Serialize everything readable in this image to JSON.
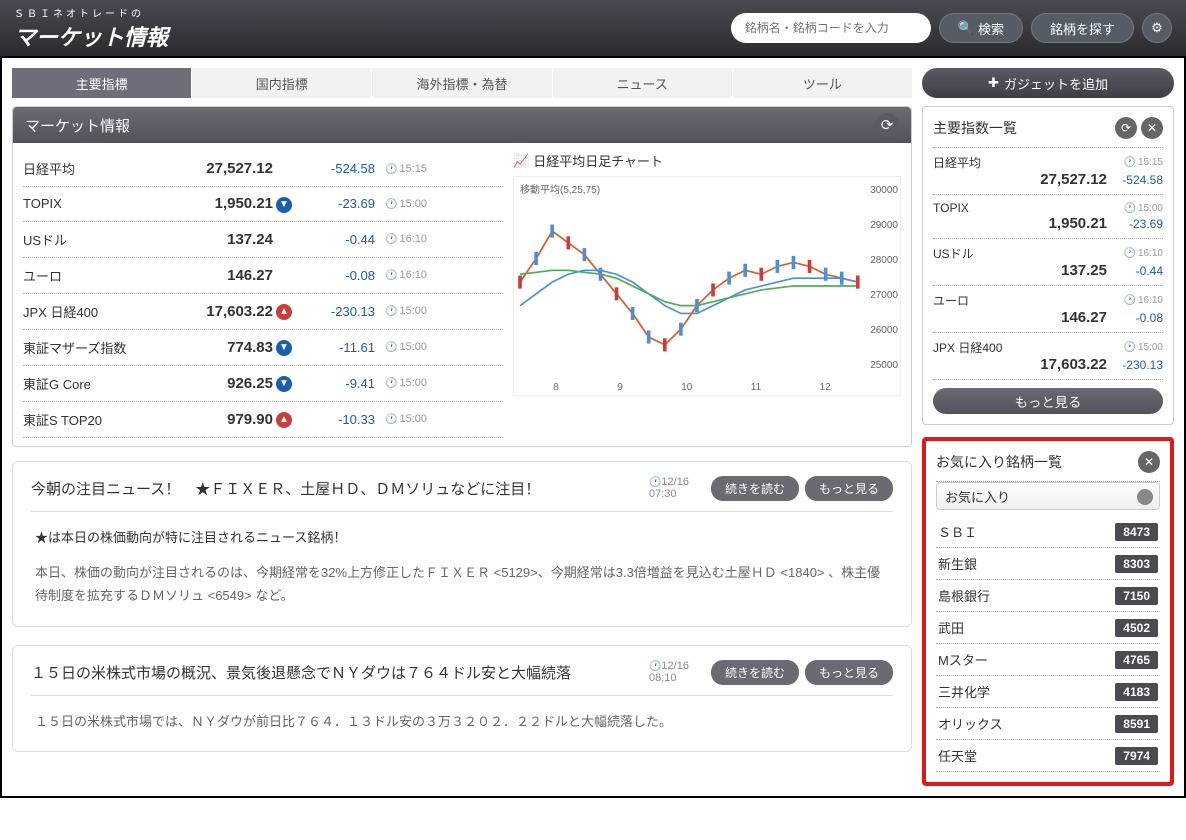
{
  "header": {
    "logo_sub": "ＳＢＩネオトレードの",
    "logo_main": "マーケット情報",
    "search_placeholder": "銘柄名・銘柄コードを入力",
    "search_btn": "検索",
    "explore_btn": "銘柄を探す"
  },
  "tabs": [
    "主要指標",
    "国内指標",
    "海外指標・為替",
    "ニュース",
    "ツール"
  ],
  "add_gadget": "ガジェットを追加",
  "market_panel_title": "マーケット情報",
  "indices": [
    {
      "name": "日経平均",
      "val": "27,527.12",
      "chg": "-524.58",
      "dir": "",
      "time": "15:15"
    },
    {
      "name": "TOPIX",
      "val": "1,950.21",
      "chg": "-23.69",
      "dir": "down",
      "time": "15:00"
    },
    {
      "name": "USドル",
      "val": "137.24",
      "chg": "-0.44",
      "dir": "",
      "time": "16:10"
    },
    {
      "name": "ユーロ",
      "val": "146.27",
      "chg": "-0.08",
      "dir": "",
      "time": "16:10"
    },
    {
      "name": "JPX 日経400",
      "val": "17,603.22",
      "chg": "-230.13",
      "dir": "up",
      "time": "15:00"
    },
    {
      "name": "東証マザーズ指数",
      "val": "774.83",
      "chg": "-11.61",
      "dir": "down",
      "time": "15:00"
    },
    {
      "name": "東証G Core",
      "val": "926.25",
      "chg": "-9.41",
      "dir": "down",
      "time": "15:00"
    },
    {
      "name": "東証S TOP20",
      "val": "979.90",
      "chg": "-10.33",
      "dir": "up",
      "time": "15:00"
    }
  ],
  "chart_title": "日経平均日足チャート",
  "moving_avg": "移動平均(5,25,75)",
  "chart_data": {
    "type": "line",
    "title": "日経平均日足チャート",
    "ylabel": "",
    "xlabel": "",
    "xticks": [
      "8",
      "9",
      "10",
      "11",
      "12"
    ],
    "yticks": [
      "25000",
      "26000",
      "27000",
      "28000",
      "29000",
      "30000"
    ],
    "ylim": [
      25000,
      30000
    ],
    "series": [
      {
        "name": "MA5",
        "color": "#e05a2a",
        "values": [
          27600,
          28200,
          28900,
          28600,
          28300,
          27800,
          27300,
          26800,
          26200,
          26000,
          26400,
          27000,
          27400,
          27700,
          27900,
          27800,
          28000,
          28100,
          28000,
          27800,
          27700,
          27600
        ]
      },
      {
        "name": "MA25",
        "color": "#4a90d9",
        "values": [
          27000,
          27300,
          27600,
          27800,
          27900,
          27900,
          27800,
          27600,
          27300,
          27000,
          26800,
          26800,
          27000,
          27200,
          27400,
          27500,
          27600,
          27700,
          27700,
          27700,
          27700,
          27600
        ]
      },
      {
        "name": "MA75",
        "color": "#4caf50",
        "values": [
          27800,
          27850,
          27900,
          27900,
          27850,
          27800,
          27700,
          27500,
          27300,
          27100,
          27000,
          27000,
          27100,
          27200,
          27300,
          27400,
          27450,
          27500,
          27500,
          27500,
          27500,
          27500
        ]
      }
    ]
  },
  "news": [
    {
      "title": "今朝の注目ニュース！　★ＦＩＸＥＲ、土屋ＨＤ、ＤＭソリュなどに注目！",
      "time_d": "12/16",
      "time_t": "07:30",
      "highlight": "★は本日の株価動向が特に注目されるニュース銘柄！",
      "body": "本日、株価の動向が注目されるのは、今期経常を32%上方修正したＦＩＸＥＲ <5129>、今期経常は3.3倍増益を見込む土屋ＨＤ <1840> 、株主優待制度を拡充するＤＭソリュ <6549> など。"
    },
    {
      "title": "１５日の米株式市場の概況、景気後退懸念でＮＹダウは７６４ドル安と大幅続落",
      "time_d": "12/16",
      "time_t": "08:10",
      "body": "１５日の米株式市場では、ＮＹダウが前日比７６４．１３ドル安の３万３２０２．２２ドルと大幅続落した。"
    }
  ],
  "btn_read": "続きを読む",
  "btn_more": "もっと見る",
  "side_panel_title": "主要指数一覧",
  "side_indices": [
    {
      "name": "日経平均",
      "val": "27,527.12",
      "chg": "-524.58",
      "time": "15:15"
    },
    {
      "name": "TOPIX",
      "val": "1,950.21",
      "chg": "-23.69",
      "time": "15:00"
    },
    {
      "name": "USドル",
      "val": "137.25",
      "chg": "-0.44",
      "time": "16:10"
    },
    {
      "name": "ユーロ",
      "val": "146.27",
      "chg": "-0.08",
      "time": "16:10"
    },
    {
      "name": "JPX 日経400",
      "val": "17,603.22",
      "chg": "-230.13",
      "time": "15:00"
    }
  ],
  "fav_title": "お気に入り銘柄一覧",
  "fav_select": "お気に入り",
  "favorites": [
    {
      "name": "ＳＢＩ",
      "code": "8473"
    },
    {
      "name": "新生銀",
      "code": "8303"
    },
    {
      "name": "島根銀行",
      "code": "7150"
    },
    {
      "name": "武田",
      "code": "4502"
    },
    {
      "name": "Mスター",
      "code": "4765"
    },
    {
      "name": "三井化学",
      "code": "4183"
    },
    {
      "name": "オリックス",
      "code": "8591"
    },
    {
      "name": "任天堂",
      "code": "7974"
    }
  ]
}
